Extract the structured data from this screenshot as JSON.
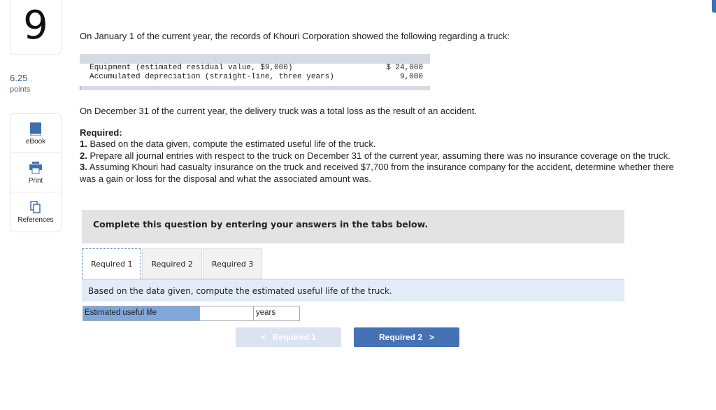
{
  "question": {
    "number": "9",
    "points_value": "6.25",
    "points_label": "points"
  },
  "tools": [
    {
      "label": "eBook",
      "icon": "book-icon"
    },
    {
      "label": "Print",
      "icon": "printer-icon"
    },
    {
      "label": "References",
      "icon": "copy-icon"
    }
  ],
  "intro": "On January 1 of the current year, the records of Khouri Corporation showed the following regarding a truck:",
  "financials": [
    {
      "label": "Equipment (estimated residual value, $9,000)",
      "amount": "$ 24,000"
    },
    {
      "label": "Accumulated depreciation (straight-line, three years)",
      "amount": "9,000"
    }
  ],
  "event": "On December 31 of the current year, the delivery truck was a total loss as the result of an accident.",
  "required_title": "Required:",
  "requirements": [
    {
      "num": "1.",
      "text": " Based on the data given, compute the estimated useful life of the truck."
    },
    {
      "num": "2.",
      "text": " Prepare all journal entries with respect to the truck on December 31 of the current year, assuming there was no insurance coverage on the truck."
    },
    {
      "num": "3.",
      "text": " Assuming Khouri had casualty insurance on the truck and received $7,700 from the insurance company for the accident, determine whether there was a gain or loss for the disposal and what the associated amount was."
    }
  ],
  "instructions_box": "Complete this question by entering your answers in the tabs below.",
  "tabs": [
    "Required 1",
    "Required 2",
    "Required 3"
  ],
  "tab_instruction": "Based on the data given, compute the estimated useful life of the truck.",
  "answer": {
    "label": "Estimated useful life",
    "value": "",
    "unit": "years"
  },
  "nav": {
    "prev": "Required 1",
    "next": "Required 2"
  }
}
